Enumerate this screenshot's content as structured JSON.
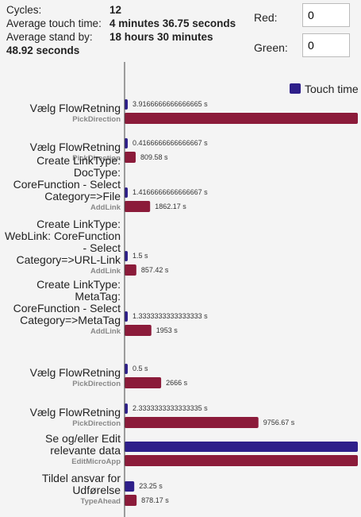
{
  "stats": {
    "cycles_label": "Cycles:",
    "cycles_value": "12",
    "avg_touch_label": "Average touch time:",
    "avg_touch_value": "4 minutes 36.75 seconds",
    "avg_standby_label": "Average stand by:",
    "avg_standby_value_line1": "18 hours 30 minutes",
    "avg_standby_value_line2": "48.92 seconds"
  },
  "controls": {
    "red_label": "Red:",
    "red_value": "0",
    "green_label": "Green:",
    "green_value": "0"
  },
  "chart_data": {
    "type": "bar",
    "orientation": "horizontal",
    "legend": {
      "position": "top-right",
      "entries": [
        "Touch time"
      ]
    },
    "categories": [
      {
        "label": [
          "Vælg FlowRetning"
        ],
        "sub": "PickDirection"
      },
      {
        "label": [
          "Vælg FlowRetning"
        ],
        "sub": "PickDirection"
      },
      {
        "label": [
          "Create LinkType:",
          "DocType:",
          "CoreFunction - Select",
          "Category=>File"
        ],
        "sub": "AddLink"
      },
      {
        "label": [
          "Create LinkType:",
          "WebLink: CoreFunction",
          "- Select",
          "Category=>URL-Link"
        ],
        "sub": "AddLink"
      },
      {
        "label": [
          "Create LinkType:",
          "MetaTag:",
          "CoreFunction - Select",
          "Category=>MetaTag"
        ],
        "sub": "AddLink"
      },
      {
        "label": [
          "Vælg FlowRetning"
        ],
        "sub": "PickDirection"
      },
      {
        "label": [
          "Vælg FlowRetning"
        ],
        "sub": "PickDirection"
      },
      {
        "label": [
          "Se og/eller Edit",
          "relevante data"
        ],
        "sub": "EditMicroApp"
      },
      {
        "label": [
          "Tildel ansvar for",
          "Udførelse"
        ],
        "sub": "TypeAhead"
      }
    ],
    "series": [
      {
        "name": "Touch time",
        "color": "#2e1f8a",
        "values": [
          3.9166666666666665,
          0.4166666666666667,
          1.4166666666666667,
          1.5,
          1.3333333333333333,
          0.5,
          2.3333333333333335,
          560,
          23.25
        ],
        "value_labels": [
          "3.9166666666666665 s",
          "0.4166666666666667 s",
          "1.4166666666666667 s",
          "1.5 s",
          "1.3333333333333333 s",
          "0.5 s",
          "2.3333333333333335 s",
          "",
          "23.25 s"
        ]
      },
      {
        "name": "",
        "color": "#8b1b3a",
        "values": [
          17000,
          809.58,
          1862.17,
          857.42,
          1953,
          2666,
          9756.67,
          17000,
          878.17
        ],
        "value_labels": [
          "",
          "809.58 s",
          "1862.17 s",
          "857.42 s",
          "1953 s",
          "2666 s",
          "9756.67 s",
          "",
          "878.17 s"
        ]
      }
    ],
    "scales": {
      "touch_max": 560,
      "standby_max": 17000
    },
    "grid": false
  }
}
